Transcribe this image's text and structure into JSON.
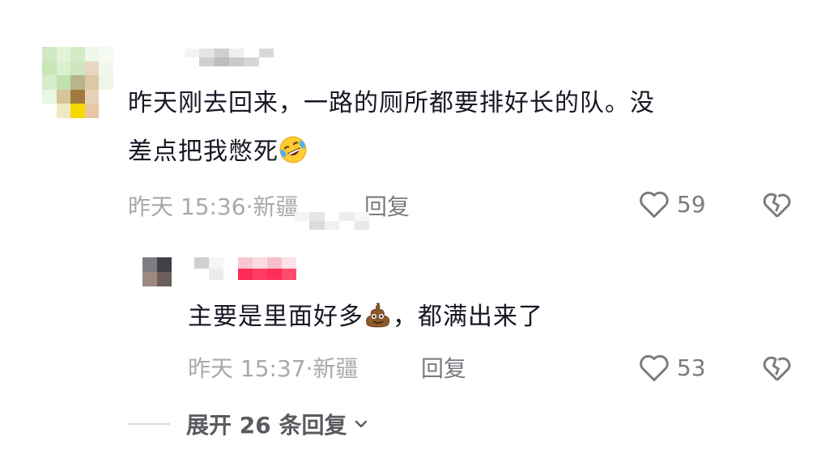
{
  "comment": {
    "text_line1": "昨天刚去回来，一路的厕所都要排好长的队。没",
    "text_line2": "差点把我憋死",
    "emoji": "rolling-on-floor-laughing-emoji",
    "time": "昨天 15:36",
    "location": "新疆",
    "reply_label": "回复",
    "likes": "59"
  },
  "reply": {
    "text_before": "主要是里面好多",
    "emoji": "pile-of-poo-emoji",
    "text_after": "，都满出来了",
    "time": "昨天 15:37",
    "location": "新疆",
    "reply_label": "回复",
    "likes": "53"
  },
  "expand": {
    "label": "展开 26 条回复"
  },
  "colors": {
    "text": "#161823",
    "meta": "#a8a9ad",
    "action": "#7a7b80"
  }
}
